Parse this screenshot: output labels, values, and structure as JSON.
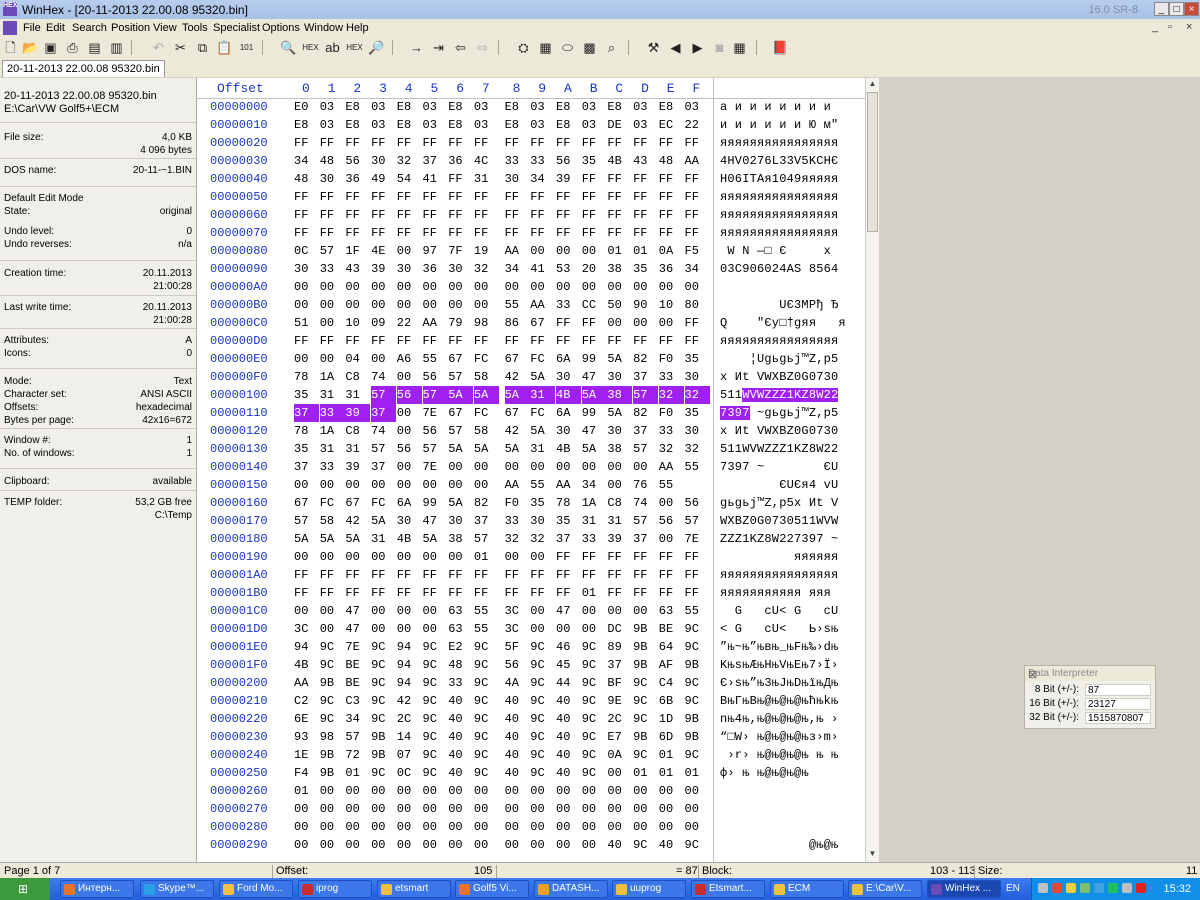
{
  "window": {
    "title": "WinHex - [20-11-2013  22.00.08  95320.bin]",
    "version": "16.0 SR-8",
    "app_icon_text": "HEX"
  },
  "menu": [
    "File",
    "Edit",
    "Search",
    "Position",
    "View",
    "Tools",
    "Specialist",
    "Options",
    "Window",
    "Help"
  ],
  "tab": "20-11-2013  22.00.08  95320.bin",
  "info": {
    "filename": "20-11-2013  22.00.08  95320.bin",
    "path": "E:\\Car\\VW Golf5+\\ECM",
    "rows": [
      {
        "k": "File size:",
        "v": "4,0 KB"
      },
      {
        "k": "",
        "v": "4 096 bytes"
      },
      {
        "k": "DOS name:",
        "v": "20-11-~1.BIN"
      },
      {
        "k": "Default Edit Mode",
        "v": ""
      },
      {
        "k": "State:",
        "v": "original"
      },
      {
        "k": "Undo level:",
        "v": "0"
      },
      {
        "k": "Undo reverses:",
        "v": "n/a"
      },
      {
        "k": "Creation time:",
        "v": "20.11.2013"
      },
      {
        "k": "",
        "v": "21:00:28"
      },
      {
        "k": "Last write time:",
        "v": "20.11.2013"
      },
      {
        "k": "",
        "v": "21:00:28"
      },
      {
        "k": "Attributes:",
        "v": "A"
      },
      {
        "k": "Icons:",
        "v": "0"
      },
      {
        "k": "Mode:",
        "v": "Text"
      },
      {
        "k": "Character set:",
        "v": "ANSI ASCII"
      },
      {
        "k": "Offsets:",
        "v": "hexadecimal"
      },
      {
        "k": "Bytes per page:",
        "v": "42x16=672"
      },
      {
        "k": "Window #:",
        "v": "1"
      },
      {
        "k": "No. of windows:",
        "v": "1"
      },
      {
        "k": "Clipboard:",
        "v": "available"
      },
      {
        "k": "TEMP folder:",
        "v": "53,2 GB free"
      },
      {
        "k": "",
        "v": "C:\\Temp"
      }
    ]
  },
  "hex": {
    "header_offset": "Offset",
    "columns": [
      "0",
      "1",
      "2",
      "3",
      "4",
      "5",
      "6",
      "7",
      "8",
      "9",
      "A",
      "B",
      "C",
      "D",
      "E",
      "F"
    ],
    "rows": [
      {
        "off": "00000000",
        "b": "E0 03 E8 03 E8 03 E8 03 E8 03 E8 03 E8 03 E8 03",
        "a": "а и и и и и и и"
      },
      {
        "off": "00000010",
        "b": "E8 03 E8 03 E8 03 E8 03 E8 03 E8 03 DE 03 EC 22",
        "a": "и и и и и и Ю м\""
      },
      {
        "off": "00000020",
        "b": "FF FF FF FF FF FF FF FF FF FF FF FF FF FF FF FF",
        "a": "яяяяяяяяяяяяяяяя"
      },
      {
        "off": "00000030",
        "b": "34 48 56 30 32 37 36 4C 33 33 56 35 4B 43 48 AA",
        "a": "4HV0276L33V5KCHЄ"
      },
      {
        "off": "00000040",
        "b": "48 30 36 49 54 41 FF 31 30 34 39 FF FF FF FF FF",
        "a": "H06ITAя1049яяяяя"
      },
      {
        "off": "00000050",
        "b": "FF FF FF FF FF FF FF FF FF FF FF FF FF FF FF FF",
        "a": "яяяяяяяяяяяяяяяя"
      },
      {
        "off": "00000060",
        "b": "FF FF FF FF FF FF FF FF FF FF FF FF FF FF FF FF",
        "a": "яяяяяяяяяяяяяяяя"
      },
      {
        "off": "00000070",
        "b": "FF FF FF FF FF FF FF FF FF FF FF FF FF FF FF FF",
        "a": "яяяяяяяяяяяяяяяя"
      },
      {
        "off": "00000080",
        "b": "0C 57 1F 4E 00 97 7F 19 AA 00 00 00 01 01 0A F5",
        "a": " W N —□ Є     х"
      },
      {
        "off": "00000090",
        "b": "30 33 43 39 30 36 30 32 34 41 53 20 38 35 36 34",
        "a": "03C906024AS 8564"
      },
      {
        "off": "000000A0",
        "b": "00 00 00 00 00 00 00 00 00 00 00 00 00 00 00 00",
        "a": ""
      },
      {
        "off": "000000B0",
        "b": "00 00 00 00 00 00 00 00 55 AA 33 CC 50 90 10 80",
        "a": "        UЄ3MPђ Ђ"
      },
      {
        "off": "000000C0",
        "b": "51 00 10 09 22 AA 79 98 86 67 FF FF 00 00 00 FF",
        "a": "Q    \"Єy□†gяя   я"
      },
      {
        "off": "000000D0",
        "b": "FF FF FF FF FF FF FF FF FF FF FF FF FF FF FF FF",
        "a": "яяяяяяяяяяяяяяяя"
      },
      {
        "off": "000000E0",
        "b": "00 00 04 00 A6 55 67 FC 67 FC 6A 99 5A 82 F0 35",
        "a": "    ¦Ugьgьj™Z,p5"
      },
      {
        "off": "000000F0",
        "b": "78 1A C8 74 00 56 57 58 42 5A 30 47 30 37 33 30",
        "a": "x Иt VWXBZ0G0730"
      },
      {
        "off": "00000100",
        "b": "35 31 31 57 56 57 5A 5A 5A 31 4B 5A 38 57 32 32",
        "a": "511WVWZZZ1KZ8W22",
        "hl_from": 3,
        "hl_to": 15
      },
      {
        "off": "00000110",
        "b": "37 33 39 37 00 7E 67 FC 67 FC 6A 99 5A 82 F0 35",
        "a": "7397 ~gьgьj™Z,p5",
        "hl_from": 0,
        "hl_to": 3
      },
      {
        "off": "00000120",
        "b": "78 1A C8 74 00 56 57 58 42 5A 30 47 30 37 33 30",
        "a": "x Иt VWXBZ0G0730"
      },
      {
        "off": "00000130",
        "b": "35 31 31 57 56 57 5A 5A 5A 31 4B 5A 38 57 32 32",
        "a": "511WVWZZZ1KZ8W22"
      },
      {
        "off": "00000140",
        "b": "37 33 39 37 00 7E 00 00 00 00 00 00 00 00 AA 55",
        "a": "7397 ~        ЄU"
      },
      {
        "off": "00000150",
        "b": "00 00 00 00 00 00 00 00 AA 55 AA 34 00 76 55",
        "a": "        ЄUЄя4 vU"
      },
      {
        "off": "00000160",
        "b": "67 FC 67 FC 6A 99 5A 82 F0 35 78 1A C8 74 00 56",
        "a": "gьgьj™Z,p5x Иt V"
      },
      {
        "off": "00000170",
        "b": "57 58 42 5A 30 47 30 37 33 30 35 31 31 57 56 57",
        "a": "WXBZ0G0730511WVW"
      },
      {
        "off": "00000180",
        "b": "5A 5A 5A 31 4B 5A 38 57 32 32 37 33 39 37 00 7E",
        "a": "ZZZ1KZ8W227397 ~"
      },
      {
        "off": "00000190",
        "b": "00 00 00 00 00 00 00 01 00 00 FF FF FF FF FF FF",
        "a": "          яяяяяя"
      },
      {
        "off": "000001A0",
        "b": "FF FF FF FF FF FF FF FF FF FF FF FF FF FF FF FF",
        "a": "яяяяяяяяяяяяяяяя"
      },
      {
        "off": "000001B0",
        "b": "FF FF FF FF FF FF FF FF FF FF FF 01 FF FF FF FF",
        "a": "яяяяяяяяяяя яяя"
      },
      {
        "off": "000001C0",
        "b": "00 00 47 00 00 00 63 55 3C 00 47 00 00 00 63 55",
        "a": "  G   cU< G   cU"
      },
      {
        "off": "000001D0",
        "b": "3C 00 47 00 00 00 63 55 3C 00 00 00 DC 9B BE 9C",
        "a": "< G   cU<   Ь›sњ"
      },
      {
        "off": "000001E0",
        "b": "94 9C 7E 9C 94 9C E2 9C 5F 9C 46 9C 89 9B 64 9C",
        "a": "”њ~њ”њвњ_њFњ‰›dњ"
      },
      {
        "off": "000001F0",
        "b": "4B 9C BE 9C 94 9C 48 9C 56 9C 45 9C 37 9B AF 9B",
        "a": "KњsњӔњHњVњEњ7›Ї›"
      },
      {
        "off": "00000200",
        "b": "AA 9B BE 9C 94 9C 33 9C 4A 9C 44 9C BF 9C C4 9C",
        "a": "Є›sњ”њ3њJњDњїњДњ"
      },
      {
        "off": "00000210",
        "b": "C2 9C C3 9C 42 9C 40 9C 40 9C 40 9C 9E 9C 6B 9C",
        "a": "ВњГњBњ@њ@њ@њћњkњ"
      },
      {
        "off": "00000220",
        "b": "6E 9C 34 9C 2C 9C 40 9C 40 9C 40 9C 2C 9C 1D 9B",
        "a": "nњ4њ,њ@њ@њ@њ,њ ›"
      },
      {
        "off": "00000230",
        "b": "93 98 57 9B 14 9C 40 9C 40 9C 40 9C E7 9B 6D 9B",
        "a": "“□W› њ@њ@њ@њз›m›"
      },
      {
        "off": "00000240",
        "b": "1E 9B 72 9B 07 9C 40 9C 40 9C 40 9C 0A 9C 01 9C",
        "a": " ›r› њ@њ@њ@њ њ њ"
      },
      {
        "off": "00000250",
        "b": "F4 9B 01 9C 0C 9C 40 9C 40 9C 40 9C 00 01 01 01",
        "a": "ф› њ њ@њ@њ@њ"
      },
      {
        "off": "00000260",
        "b": "01 00 00 00 00 00 00 00 00 00 00 00 00 00 00 00",
        "a": ""
      },
      {
        "off": "00000270",
        "b": "00 00 00 00 00 00 00 00 00 00 00 00 00 00 00 00",
        "a": ""
      },
      {
        "off": "00000280",
        "b": "00 00 00 00 00 00 00 00 00 00 00 00 00 00 00 00",
        "a": ""
      },
      {
        "off": "00000290",
        "b": "00 00 00 00 00 00 00 00 00 00 00 00 40 9C 40 9C",
        "a": "            @њ@њ"
      }
    ]
  },
  "interpreter": {
    "title": "Data Interpreter",
    "rows": [
      {
        "k": "8 Bit (+/-):",
        "v": "87"
      },
      {
        "k": "16 Bit (+/-):",
        "v": "23127"
      },
      {
        "k": "32 Bit (+/-):",
        "v": "1515870807"
      }
    ]
  },
  "status": {
    "page": "Page 1 of 7",
    "offset_label": "Offset:",
    "offset_value": "105",
    "eq": "= 87",
    "block_label": "Block:",
    "block_value": "103 - 113",
    "size_label": "Size:",
    "size_value": "11"
  },
  "taskbar": {
    "items": [
      {
        "label": "Интерн...",
        "color": "#e8742a"
      },
      {
        "label": "Skype™...",
        "color": "#2aa0e8"
      },
      {
        "label": "Ford Mo...",
        "color": "#f0c040"
      },
      {
        "label": "iprog",
        "color": "#c83030"
      },
      {
        "label": "etsmart",
        "color": "#f0c040"
      },
      {
        "label": "Golf5 Vi...",
        "color": "#e8742a"
      },
      {
        "label": "DATASH...",
        "color": "#f0a020"
      },
      {
        "label": "uuprog",
        "color": "#f0c040"
      },
      {
        "label": "Etsmart...",
        "color": "#c83030"
      },
      {
        "label": "ECM",
        "color": "#f0c040"
      },
      {
        "label": "E:\\Car\\V...",
        "color": "#f0c040"
      },
      {
        "label": "WinHex ...",
        "color": "#6a4bb8"
      }
    ],
    "lang": "EN",
    "clock": "15:32"
  }
}
